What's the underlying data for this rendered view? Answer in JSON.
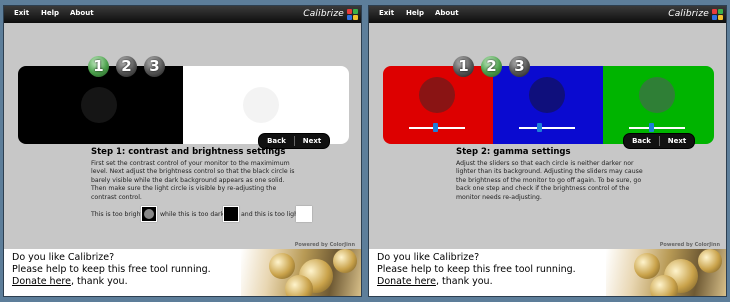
{
  "menu": [
    "Exit",
    "Help",
    "About"
  ],
  "brand": "Calibrize",
  "powered_by": "Powered by ColorJinn",
  "nav": {
    "back": "Back",
    "next": "Next"
  },
  "steps": [
    "1",
    "2",
    "3"
  ],
  "colors": {
    "accent_green": "#4ba04b",
    "slider_blue": "#1d7fd9",
    "red": "#e00000",
    "blue": "#0000cc",
    "green": "#00b400"
  },
  "icons": {
    "logo": "calibrize-cube-icon"
  },
  "panel1": {
    "active_step": 1,
    "title": "Step 1: contrast and brightness settings",
    "lines": [
      "First set the contrast control of your monitor to the maximimum",
      "level. Next adjust the brightness control so that the black circle is",
      "barely visible while the dark background appears as one solid.",
      "Then make sure the light circle is visible by re-adjusting the",
      "contrast control."
    ],
    "too_bright": "This is too bright:",
    "too_dark": "while this is too dark:",
    "too_light": "and this is too light:"
  },
  "panel2": {
    "active_step": 2,
    "title": "Step 2: gamma settings",
    "lines": [
      "Adjust the sliders so that each circle is neither darker nor",
      "lighter than its background. Adjusting the sliders may cause",
      "the brightness of the monitor to go off again. To be sure, go",
      "back one step and check if the brightness control of the",
      "monitor needs re-adjusting."
    ]
  },
  "banner": {
    "line1": "Do you like Calibrize?",
    "line2": "Please help to keep this free tool running.",
    "donate": "Donate here",
    "thanks": ", thank you."
  }
}
